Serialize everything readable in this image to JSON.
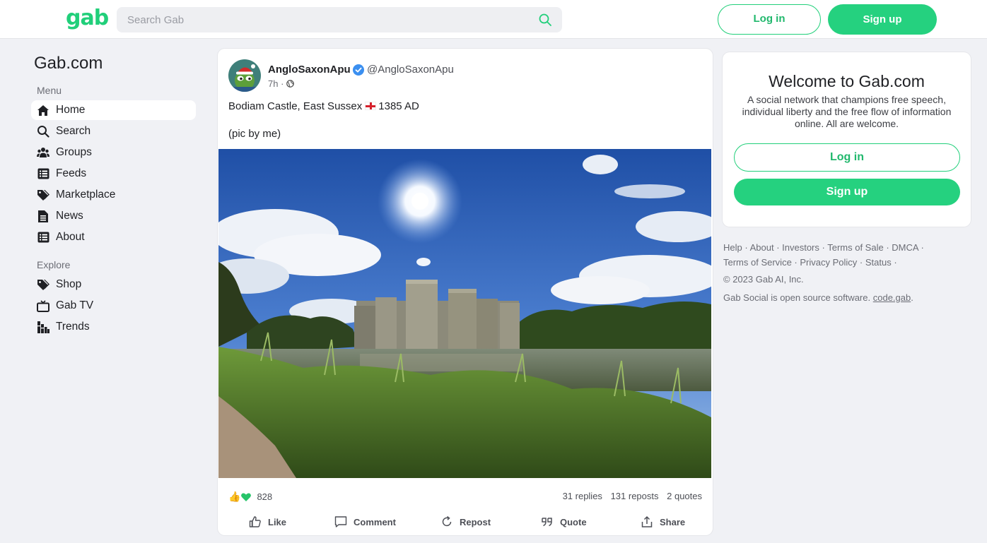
{
  "topbar": {
    "logo": "gab",
    "search_placeholder": "Search Gab",
    "login_label": "Log in",
    "signup_label": "Sign up"
  },
  "sidebar": {
    "title": "Gab.com",
    "menu_label": "Menu",
    "menu_items": [
      {
        "label": "Home",
        "icon": "home-icon",
        "active": true
      },
      {
        "label": "Search",
        "icon": "search-icon"
      },
      {
        "label": "Groups",
        "icon": "groups-icon"
      },
      {
        "label": "Feeds",
        "icon": "feeds-icon"
      },
      {
        "label": "Marketplace",
        "icon": "tag-icon"
      },
      {
        "label": "News",
        "icon": "news-icon"
      },
      {
        "label": "About",
        "icon": "about-icon"
      }
    ],
    "explore_label": "Explore",
    "explore_items": [
      {
        "label": "Shop",
        "icon": "shop-tag-icon"
      },
      {
        "label": "Gab TV",
        "icon": "tv-icon"
      },
      {
        "label": "Trends",
        "icon": "trends-icon"
      }
    ]
  },
  "post": {
    "author_name": "AngloSaxonApu",
    "author_handle": "@AngloSaxonApu",
    "time": "7h",
    "text_line1_before": "Bodiam Castle, East Sussex",
    "text_line1_after": "1385 AD",
    "text_line2": "(pic by me)",
    "reaction_count": "828",
    "replies": "31 replies",
    "reposts": "131 reposts",
    "quotes": "2 quotes",
    "actions": {
      "like": "Like",
      "comment": "Comment",
      "repost": "Repost",
      "quote": "Quote",
      "share": "Share"
    }
  },
  "welcome": {
    "title": "Welcome to Gab.com",
    "description": "A social network that champions free speech, individual liberty and the free flow of information online. All are welcome.",
    "login_label": "Log in",
    "signup_label": "Sign up"
  },
  "footer": {
    "links": [
      "Help",
      "About",
      "Investors",
      "Terms of Sale",
      "DMCA",
      "Terms of Service",
      "Privacy Policy",
      "Status"
    ],
    "copyright": "© 2023 Gab AI, Inc.",
    "oss_text": "Gab Social is open source software.",
    "oss_link": "code.gab"
  },
  "colors": {
    "accent": "#21cf7a",
    "background": "#f0f1f5"
  }
}
